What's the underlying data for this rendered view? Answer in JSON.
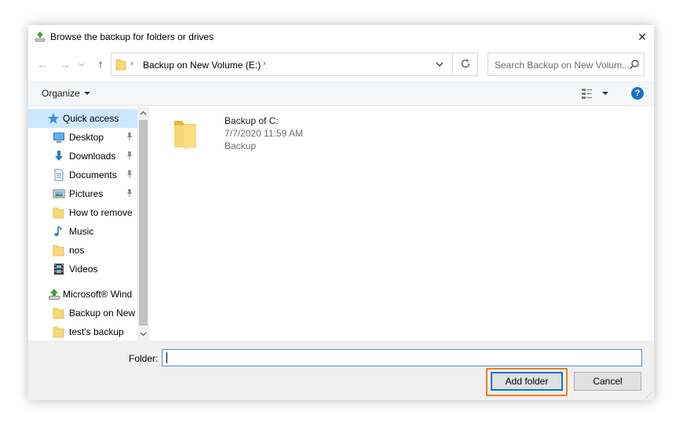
{
  "window": {
    "title": "Browse the backup for folders or drives",
    "close_glyph": "✕"
  },
  "nav": {
    "back_glyph": "←",
    "forward_glyph": "→",
    "up_glyph": "↑"
  },
  "address": {
    "separator": "›",
    "path_label": "Backup on New Volume (E:)",
    "trailing_separator": "›"
  },
  "search": {
    "placeholder": "Search Backup on New Volum..."
  },
  "toolbar": {
    "organize_label": "Organize",
    "help_label": "?"
  },
  "sidebar": {
    "items": [
      {
        "label": "Quick access",
        "icon": "star-icon",
        "pinned": false,
        "selected": true
      },
      {
        "label": "Desktop",
        "icon": "desktop-icon",
        "pinned": true
      },
      {
        "label": "Downloads",
        "icon": "download-arrow-icon",
        "pinned": true
      },
      {
        "label": "Documents",
        "icon": "document-icon",
        "pinned": true
      },
      {
        "label": "Pictures",
        "icon": "pictures-icon",
        "pinned": true
      },
      {
        "label": "How to remove",
        "icon": "folder-icon",
        "pinned": false
      },
      {
        "label": "Music",
        "icon": "music-note-icon",
        "pinned": false
      },
      {
        "label": "nos",
        "icon": "folder-icon",
        "pinned": false
      },
      {
        "label": "Videos",
        "icon": "film-icon",
        "pinned": false
      },
      {
        "label": "Microsoft® Wind",
        "icon": "backup-app-icon",
        "pinned": false
      },
      {
        "label": "Backup on New",
        "icon": "folder-icon",
        "pinned": false
      },
      {
        "label": "test's backup",
        "icon": "folder-icon",
        "pinned": false
      }
    ]
  },
  "files": [
    {
      "name": "Backup of C:",
      "date": "7/7/2020 11:59 AM",
      "type": "Backup"
    }
  ],
  "footer": {
    "folder_label": "Folder:",
    "folder_value": "",
    "add_button": "Add folder",
    "cancel_button": "Cancel"
  },
  "colors": {
    "selection": "#cce8ff",
    "folder_yellow": "#f8d775",
    "accent_blue": "#0078d7",
    "highlight_orange": "#f07e1f"
  }
}
